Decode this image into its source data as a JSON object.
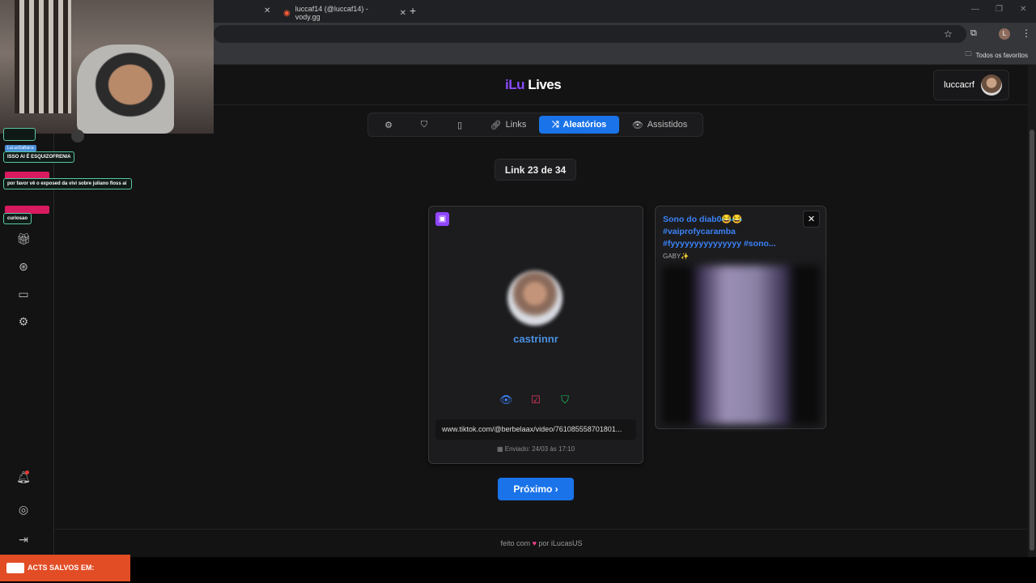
{
  "browser": {
    "active_tab_title": "luccaf14 (@luccaf14) - vody.gg",
    "bookmarks_label": "Todos os favoritos"
  },
  "app": {
    "logo_part1": "iLu",
    "logo_part2": "Lives",
    "username": "luccacrf"
  },
  "nav": {
    "links": "Links",
    "random": "Aleatórios",
    "watched": "Assistidos"
  },
  "counter": "Link 23 de 34",
  "card": {
    "name": "castrinnr",
    "url": "www.tiktok.com/@berbelaax/video/761085558701801...",
    "date": "Enviado: 24/03 às 17:10"
  },
  "card2": {
    "title": "Sono do diab0😂😂 #vaiprofycaramba #fyyyyyyyyyyyyyyy #sono...",
    "author": "GABY✨"
  },
  "next_label": "Próximo ›",
  "footer": {
    "pre": "feito com",
    "post": "por iLucasUS"
  },
  "overlay": {
    "chat1_name": "LuLuxDaBaica",
    "chat1_text": "ISSO AI É ESQUIZOFRENIA",
    "chat2_text": "por favor vê o exposed da vivi sobre juliano floss aí",
    "chat3_text": "curiosao",
    "promo": "ACTS SALVOS EM:"
  },
  "colors": {
    "accent": "#1a73e8",
    "twitch": "#9146ff",
    "link_blue": "#4a90e2"
  }
}
